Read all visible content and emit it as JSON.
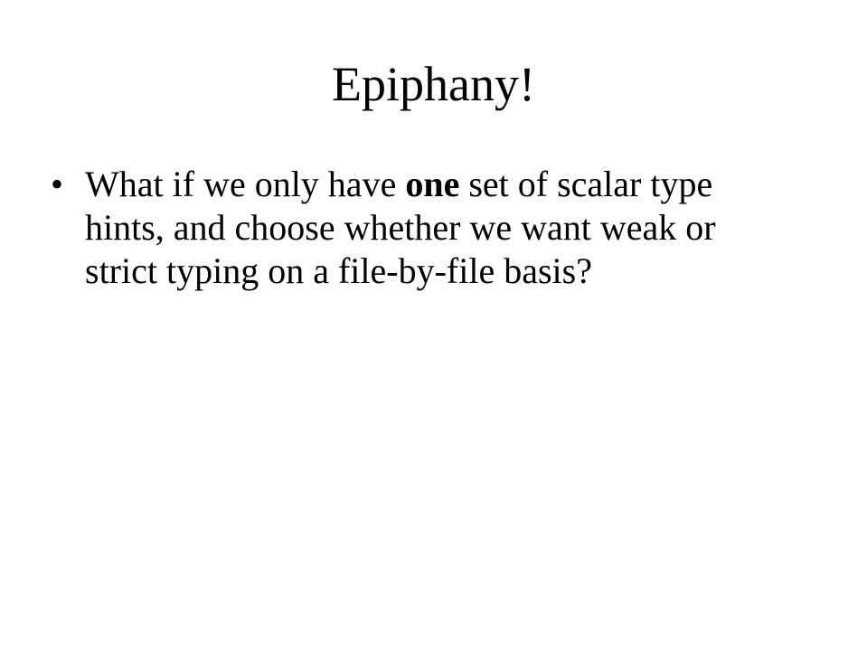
{
  "slide": {
    "title": "Epiphany!",
    "bullets": [
      {
        "marker": "•",
        "text_before": "What if we only have ",
        "text_bold": "one",
        "text_after": " set of scalar type hints, and choose whether we want weak or strict typing on a file-by-file basis?"
      }
    ]
  }
}
